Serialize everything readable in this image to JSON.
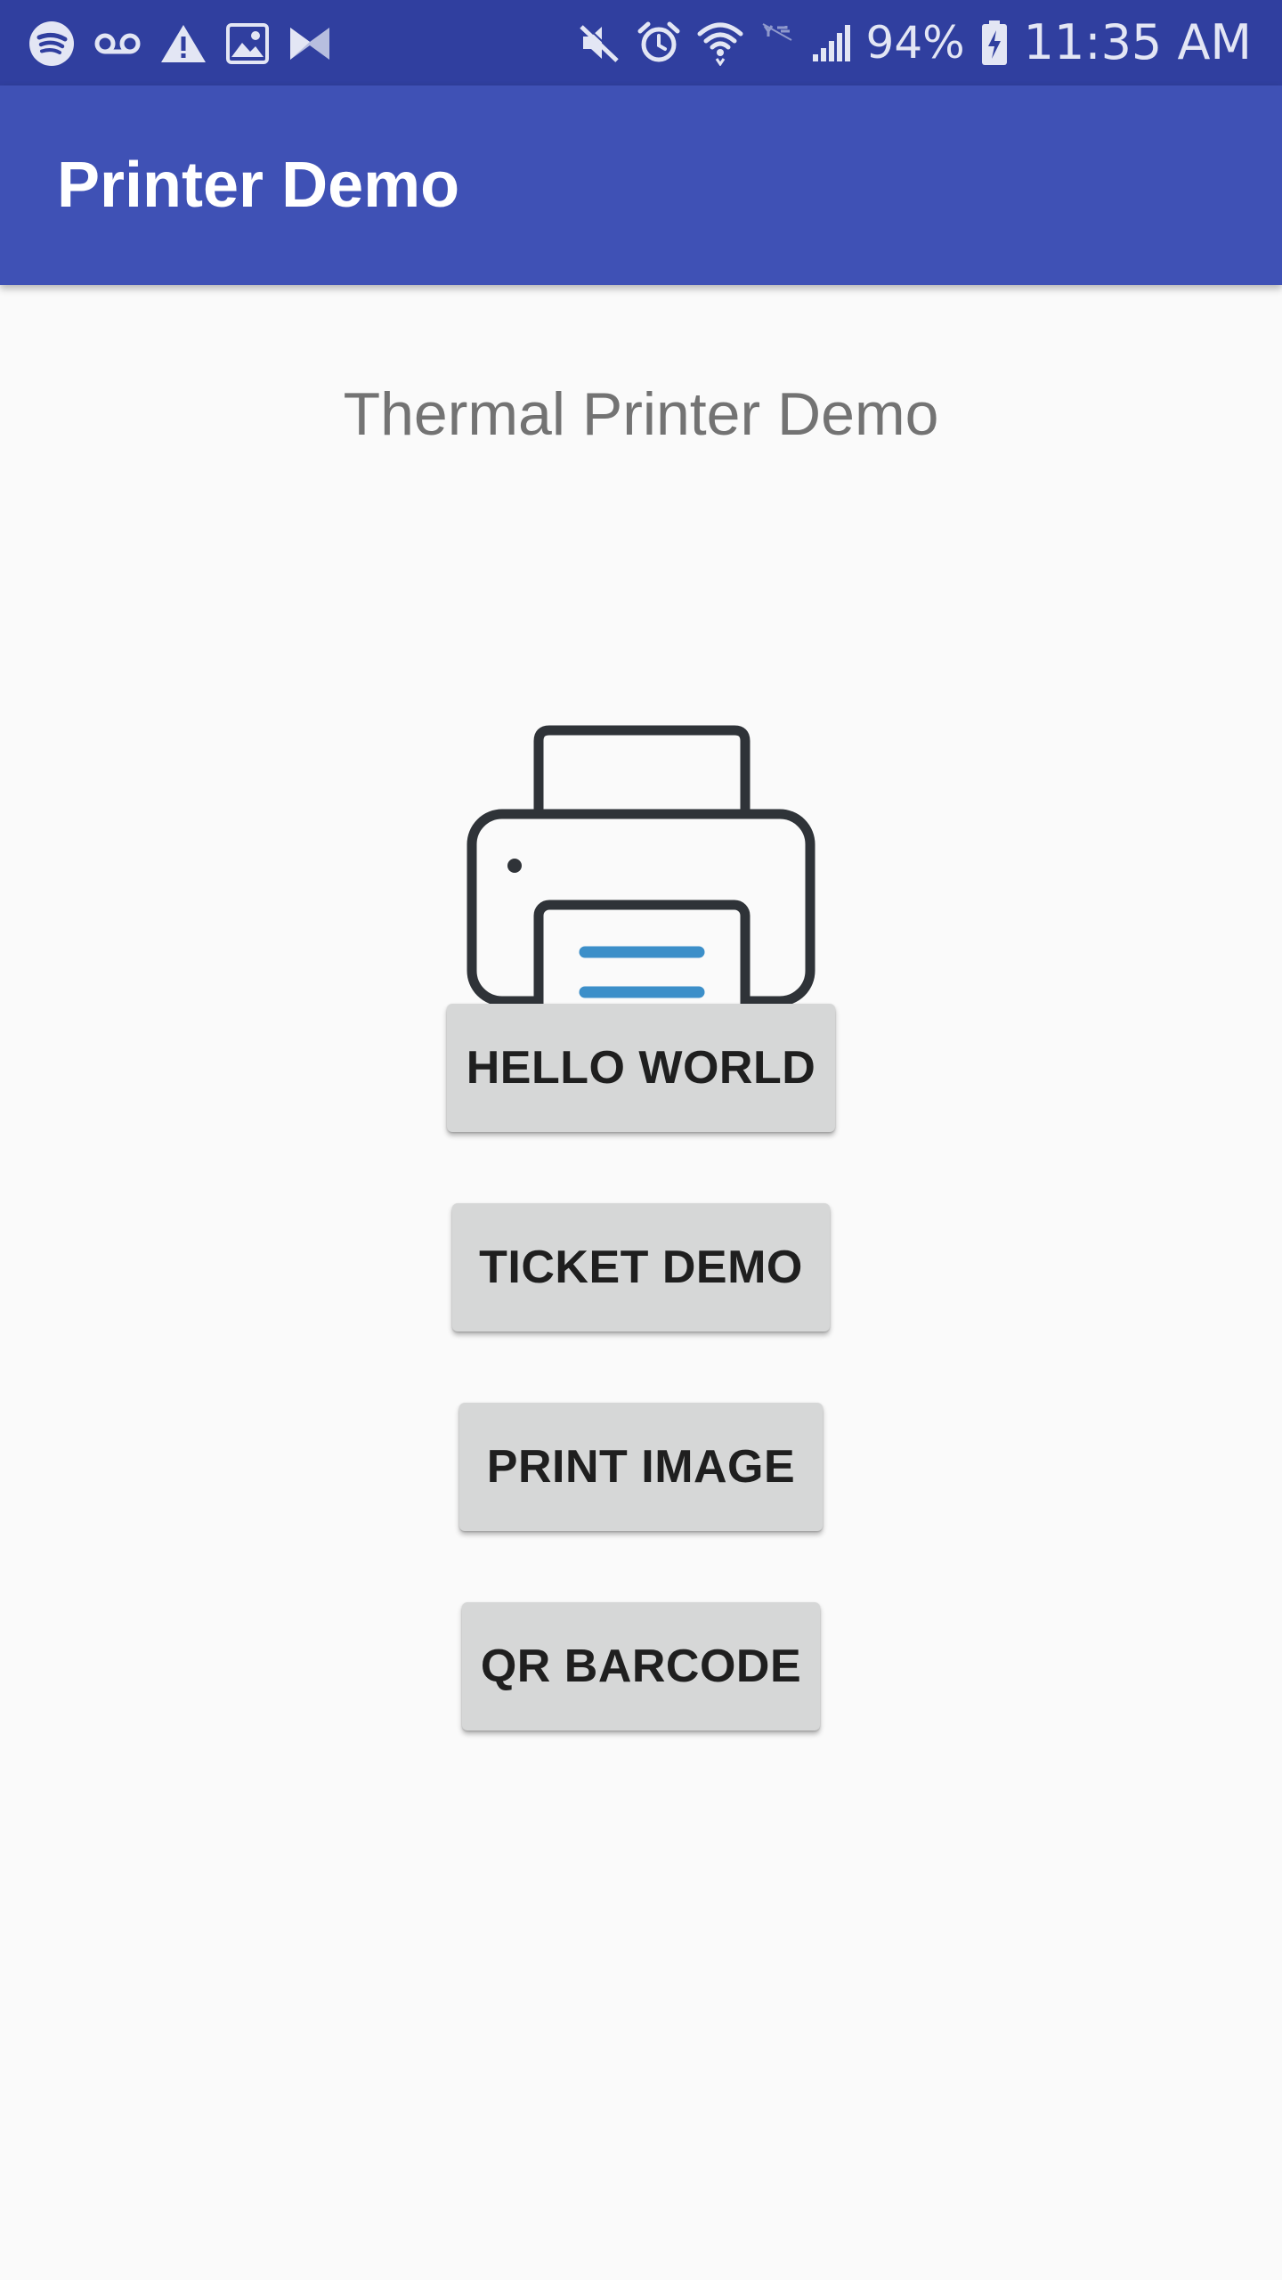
{
  "status_bar": {
    "left_icons": [
      "spotify-icon",
      "voicemail-icon",
      "warning-icon",
      "image-icon",
      "app-notification-icon"
    ],
    "right_icons": [
      "mute-icon",
      "alarm-icon",
      "wifi-icon",
      "no-data-icon",
      "signal-icon",
      "battery-charging-icon"
    ],
    "battery": "94%",
    "time": "11:35 AM"
  },
  "app_bar": {
    "title": "Printer Demo",
    "color": "#3f51b5",
    "status_color": "#303f9f"
  },
  "main": {
    "subtitle": "Thermal Printer Demo",
    "illustration": "printer-icon",
    "buttons": [
      {
        "label": "HELLO WORLD"
      },
      {
        "label": "TICKET DEMO"
      },
      {
        "label": "PRINT IMAGE"
      },
      {
        "label": "QR BARCODE"
      }
    ]
  },
  "colors": {
    "background": "#fafafa",
    "button": "#d6d7d7",
    "printer_outline": "#2f3338",
    "paper_lines": "#3c8fc9"
  }
}
